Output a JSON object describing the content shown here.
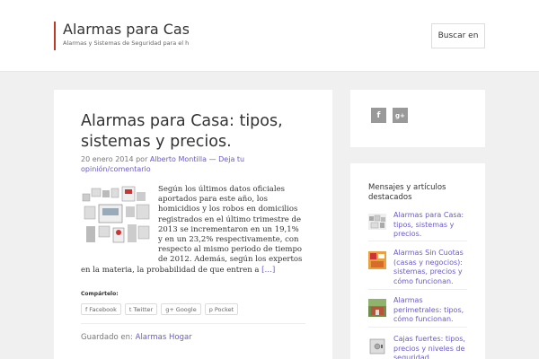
{
  "header": {
    "site_title": "Alarmas para Casas",
    "site_description": "Alarmas y Sistemas de Seguridad para el h",
    "search_label": "Buscar en"
  },
  "post": {
    "title": "Alarmas para Casa: tipos, sistemas y precios.",
    "date": "20 enero 2014",
    "by": "por",
    "author": "Alberto Montilla",
    "separator": "—",
    "comment_link": "Deja tu opinión/comentario",
    "excerpt": "Según los últimos datos oficiales aportados para este año, los homicidios y los robos en domicilios registrados en el último trimestre de 2013 se incrementaron en un 19,1% y en un 23,2% respectivamente, con respecto al mismo periodo de tiempo de 2012. Además, según los expertos en la materia, la probabilidad de que entren a",
    "more": "[…]",
    "share_label": "Compártelo:",
    "share_buttons": [
      {
        "icon": "facebook-icon",
        "glyph": "f",
        "label": "Facebook"
      },
      {
        "icon": "twitter-icon",
        "glyph": "t",
        "label": "Twitter"
      },
      {
        "icon": "google-plus-icon",
        "glyph": "g+",
        "label": "Google"
      },
      {
        "icon": "pocket-icon",
        "glyph": "p",
        "label": "Pocket"
      }
    ],
    "filed_label": "Guardado en:",
    "category": "Alarmas Hogar"
  },
  "social": [
    {
      "icon": "facebook-icon",
      "glyph": "f"
    },
    {
      "icon": "google-plus-icon",
      "glyph": "g+"
    }
  ],
  "featured": {
    "title": "Mensajes y artículos destacados",
    "items": [
      {
        "label": "Alarmas para Casa: tipos, sistemas y precios."
      },
      {
        "label": "Alarmas Sin Cuotas (casas y negocios): sistemas, precios y cómo funcionan."
      },
      {
        "label": "Alarmas perimetrales: tipos, cómo funcionan."
      },
      {
        "label": "Cajas fuertes: tipos, precios y niveles de seguridad."
      }
    ]
  },
  "colors": {
    "accent": "#c0392b",
    "link": "#6a5acd",
    "background": "#f0f0f0"
  }
}
